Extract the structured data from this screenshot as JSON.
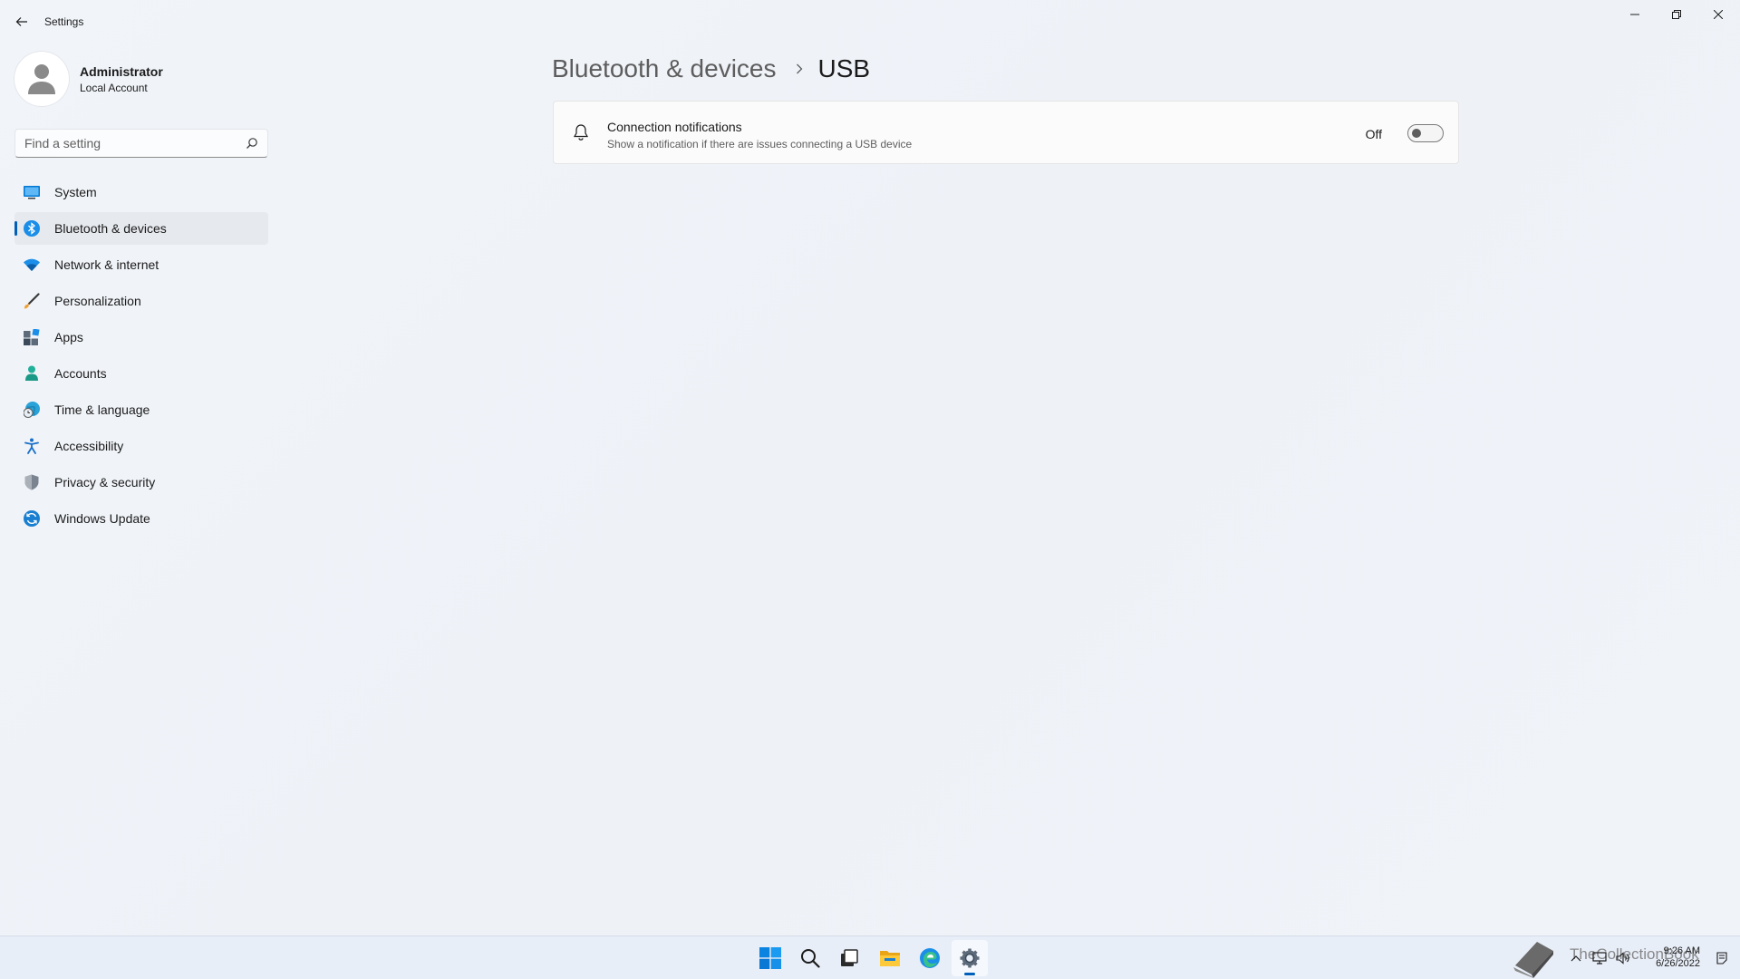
{
  "window": {
    "title": "Settings",
    "controls": {
      "minimize": "minimize",
      "restore": "restore",
      "close": "close"
    }
  },
  "user": {
    "name": "Administrator",
    "account_type": "Local Account"
  },
  "search": {
    "placeholder": "Find a setting"
  },
  "nav": {
    "selected_index": 1,
    "items": [
      {
        "label": "System",
        "icon": "monitor-icon"
      },
      {
        "label": "Bluetooth & devices",
        "icon": "bluetooth-icon"
      },
      {
        "label": "Network & internet",
        "icon": "wifi-icon"
      },
      {
        "label": "Personalization",
        "icon": "brush-icon"
      },
      {
        "label": "Apps",
        "icon": "apps-icon"
      },
      {
        "label": "Accounts",
        "icon": "person-icon"
      },
      {
        "label": "Time & language",
        "icon": "globe-clock-icon"
      },
      {
        "label": "Accessibility",
        "icon": "accessibility-icon"
      },
      {
        "label": "Privacy & security",
        "icon": "shield-icon"
      },
      {
        "label": "Windows Update",
        "icon": "update-icon"
      }
    ]
  },
  "breadcrumb": {
    "parent": "Bluetooth & devices",
    "current": "USB"
  },
  "settings": [
    {
      "title": "Connection notifications",
      "description": "Show a notification if there are issues connecting a USB device",
      "state_label": "Off",
      "enabled": false
    }
  ],
  "taskbar": {
    "apps": [
      "start-icon",
      "search-icon",
      "task-view-icon",
      "file-explorer-icon",
      "edge-icon",
      "settings-icon"
    ],
    "active_app": "settings-icon",
    "clock": {
      "time": "9:26 AM",
      "date": "6/26/2022"
    }
  },
  "watermark": {
    "text": "TheCollectionBook"
  },
  "colors": {
    "accent": "#005fb8",
    "background": "#eef2f8",
    "card": "#fbfbfc"
  }
}
